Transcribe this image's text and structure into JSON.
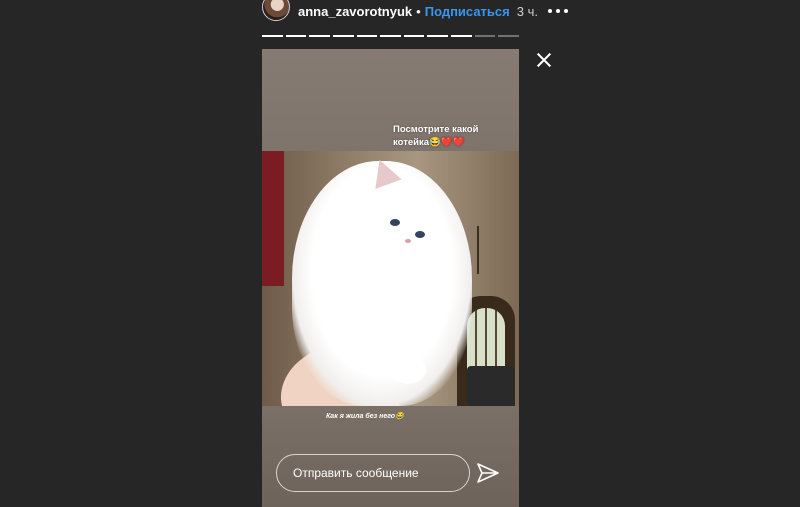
{
  "header": {
    "username": "anna_zavorotnyuk",
    "separator": "•",
    "follow_label": "Подписаться",
    "time": "3 ч."
  },
  "progress": {
    "total_segments": 11,
    "completed_segments": 9
  },
  "story": {
    "caption_top": "Посмотрите какой котейка😂❤️❤️",
    "caption_bottom": "Как я жила без него😂"
  },
  "reply": {
    "placeholder": "Отправить сообщение"
  },
  "icons": {
    "more": "more-dots-icon",
    "close": "close-icon",
    "send": "send-icon"
  },
  "colors": {
    "background": "#262626",
    "link": "#3897f0"
  }
}
